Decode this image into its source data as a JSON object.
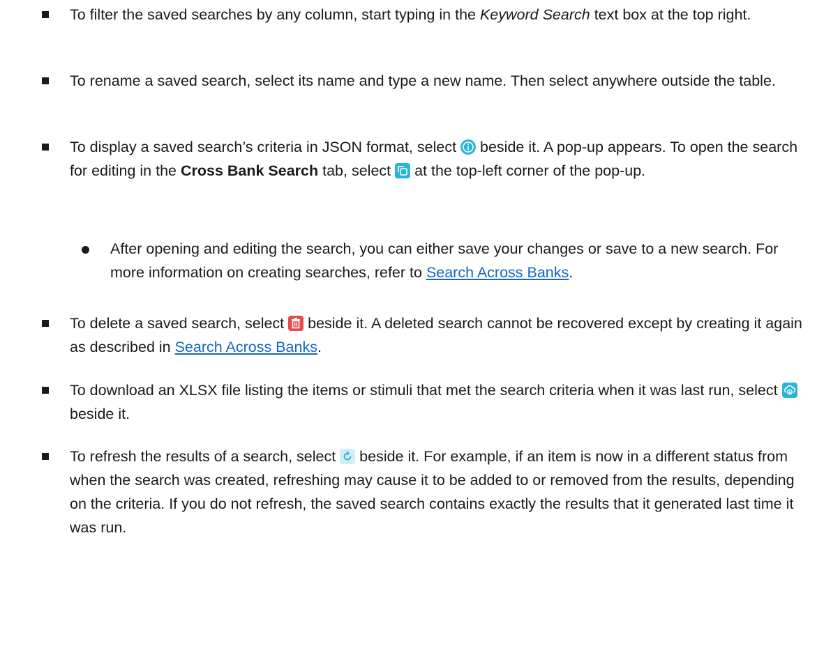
{
  "bullets": [
    {
      "pre": "To filter the saved searches by any column, start typing in the ",
      "em": "Keyword Search",
      "post": " text box at the top right."
    },
    {
      "text": "To rename a saved search, select its name and type a new name. Then select anywhere outside the table."
    },
    {
      "a": "To display a saved search’s criteria in JSON format, select ",
      "b": " beside it. A pop-up appears. To open the search for editing in the ",
      "bold": "Cross Bank Search",
      "c": " tab, select ",
      "d": " at the top-left corner of the pop-up."
    },
    {
      "a": "To delete a saved search, select ",
      "b": " beside it. A deleted search cannot be recovered except by creating it again as described in ",
      "link": "Search Across Banks",
      "c": "."
    },
    {
      "a": "To download an XLSX file listing the items or stimuli that met the search criteria when it was last run, select ",
      "b": " beside it."
    },
    {
      "a": "To refresh the results of a search, select ",
      "b": " beside it. For example, if an item is now in a different status from when the search was created, refreshing may cause it to be added to or removed from the results, depending on the criteria. If you do not refresh, the saved search contains exactly the results that it generated last time it was run."
    }
  ],
  "sub_bullet": {
    "a": "After opening and editing the search, you can either save your changes or save to a new search. For more information on creating searches, refer to ",
    "link": "Search Across Banks",
    "b": "."
  },
  "icons": {
    "info": "info-icon",
    "copy": "open-copy-icon",
    "delete": "trash-icon",
    "download": "cloud-download-icon",
    "refresh": "refresh-icon"
  },
  "colors": {
    "accent": "#29b6d6",
    "danger": "#e74c4c",
    "link": "#1565c0"
  }
}
